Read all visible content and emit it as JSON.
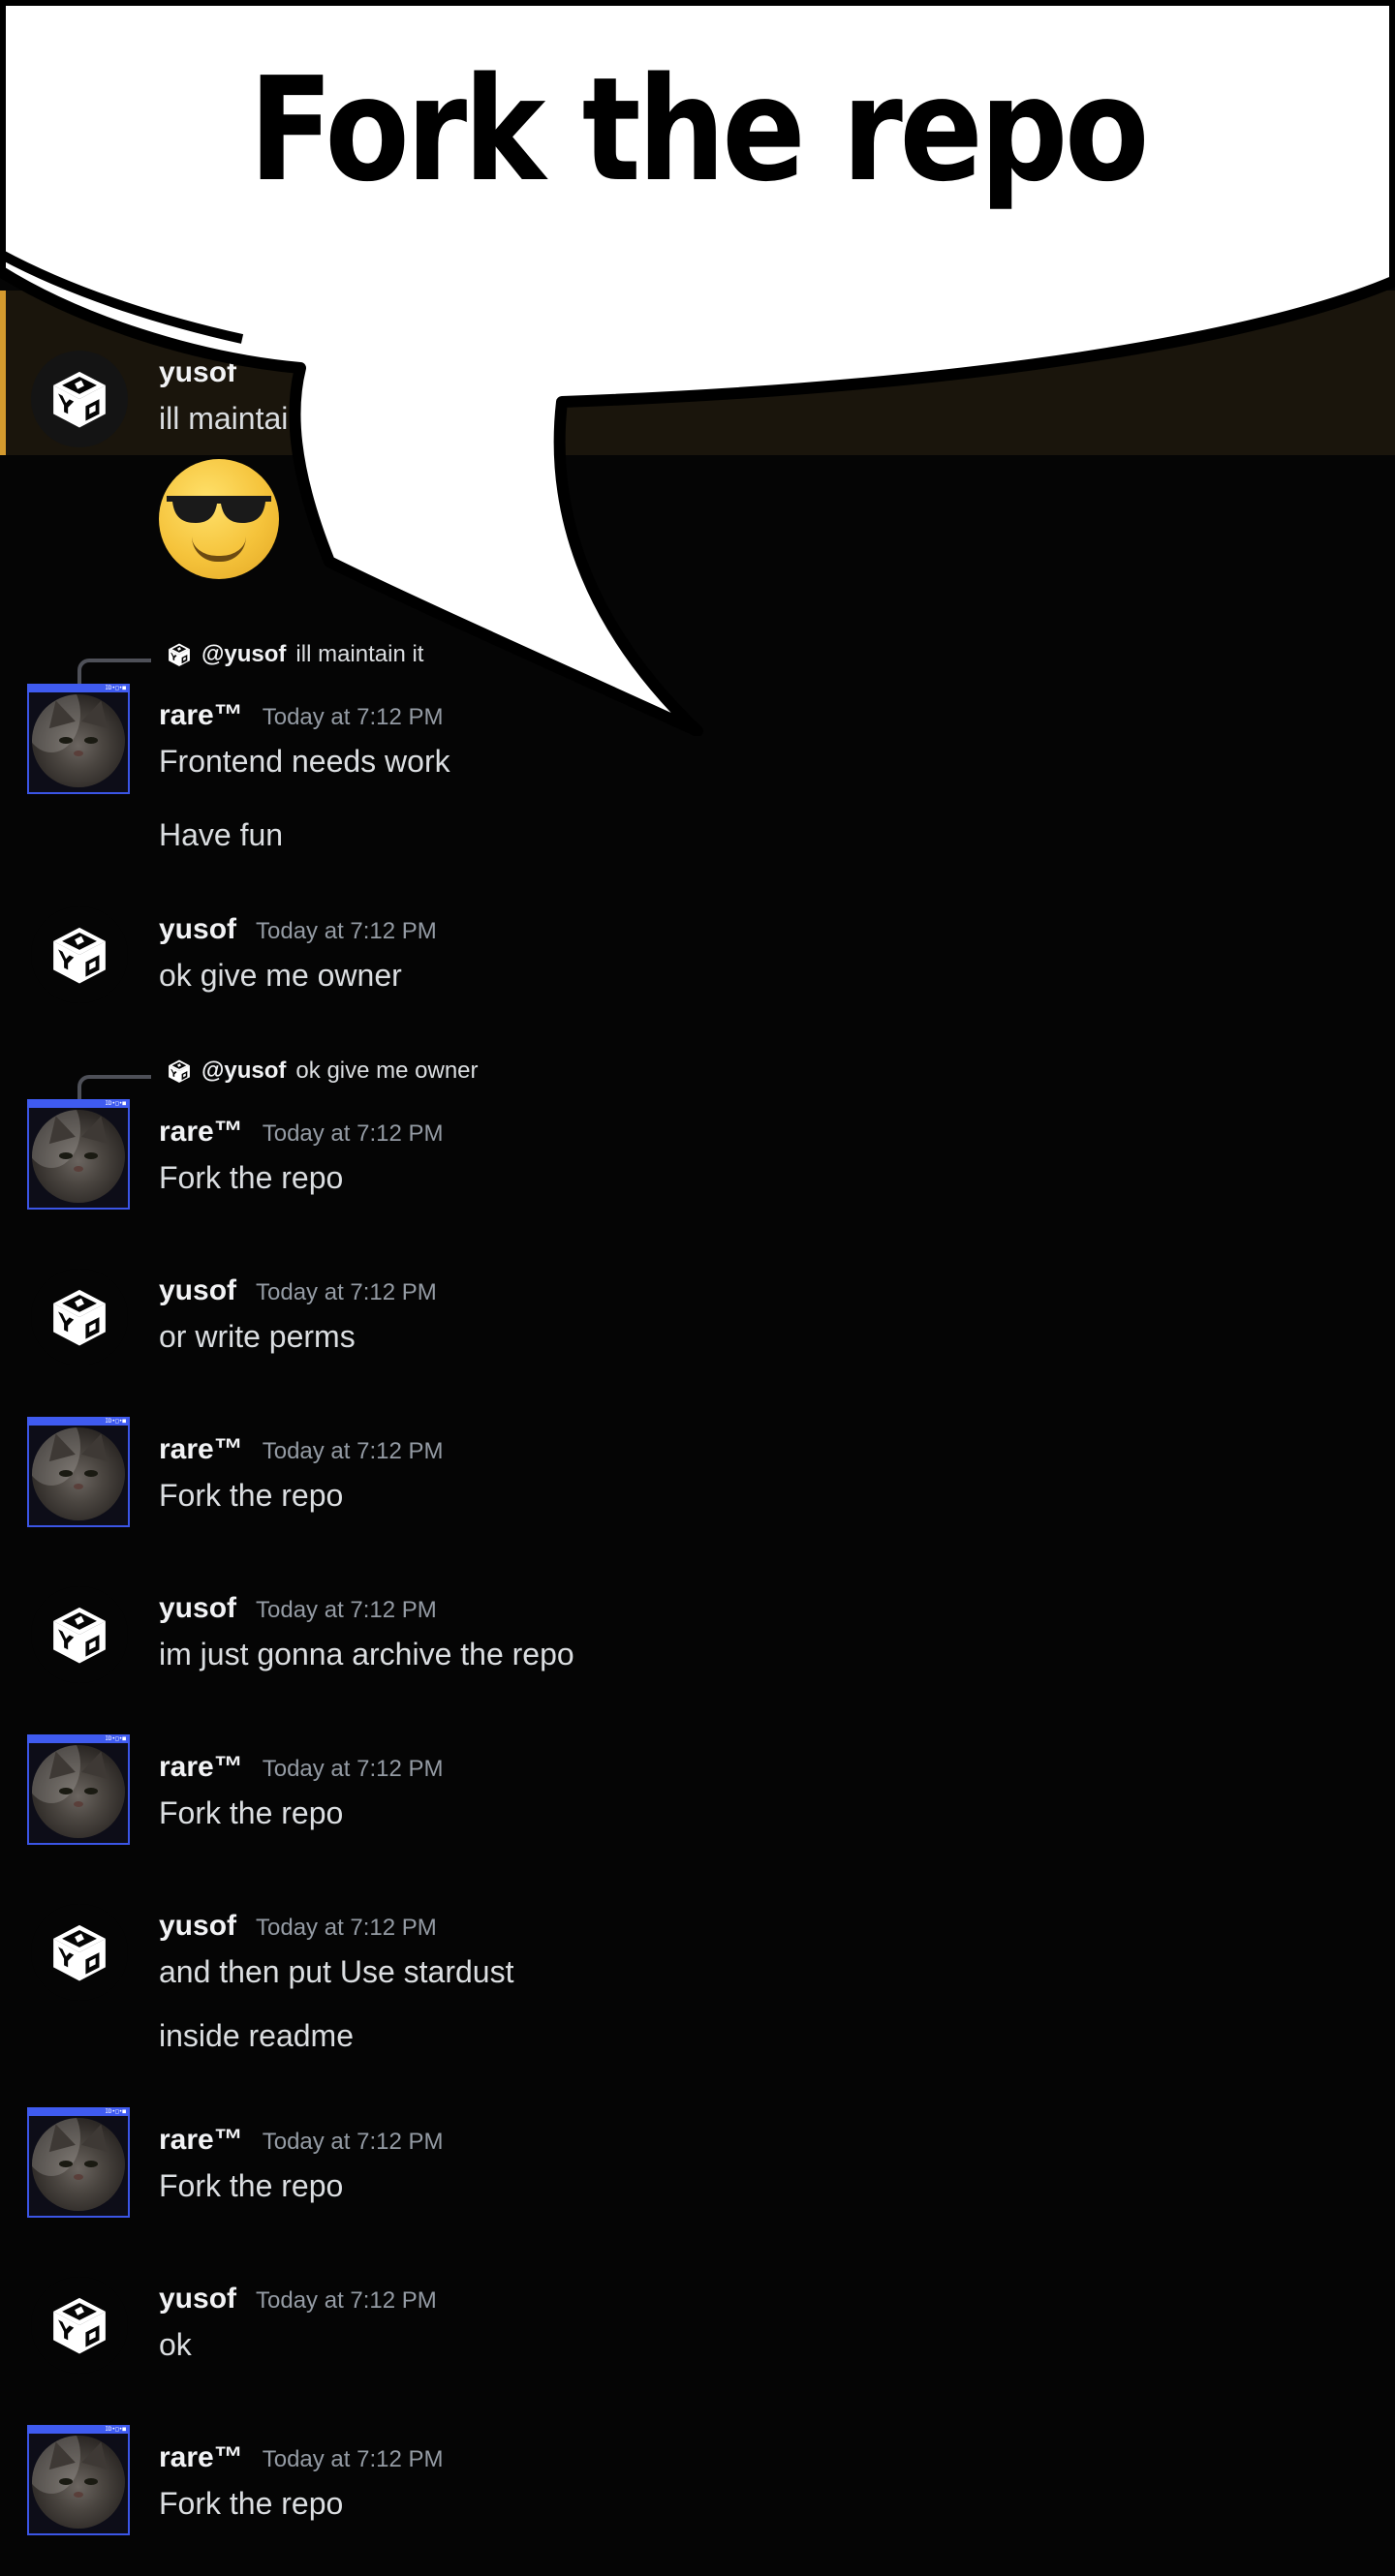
{
  "meme_caption": "Fork the repo",
  "first_message": {
    "author_partial": "yusof",
    "text_partial": "ill maintain it"
  },
  "emoji": "sunglasses-emoji",
  "messages": [
    {
      "author": "rare™",
      "timestamp": "Today at 7:12 PM",
      "reply_to": {
        "mention": "@yusof",
        "text": "ill maintain it"
      },
      "lines": [
        "Frontend needs work",
        "Have fun"
      ]
    },
    {
      "author": "yusof",
      "timestamp": "Today at 7:12 PM",
      "lines": [
        "ok give me owner"
      ]
    },
    {
      "author": "rare™",
      "timestamp": "Today at 7:12 PM",
      "reply_to": {
        "mention": "@yusof",
        "text": "ok give me owner"
      },
      "lines": [
        "Fork the repo"
      ]
    },
    {
      "author": "yusof",
      "timestamp": "Today at 7:12 PM",
      "lines": [
        "or write perms"
      ]
    },
    {
      "author": "rare™",
      "timestamp": "Today at 7:12 PM",
      "lines": [
        "Fork the repo"
      ]
    },
    {
      "author": "yusof",
      "timestamp": "Today at 7:12 PM",
      "lines": [
        "im just gonna archive the repo"
      ]
    },
    {
      "author": "rare™",
      "timestamp": "Today at 7:12 PM",
      "lines": [
        "Fork the repo"
      ]
    },
    {
      "author": "yusof",
      "timestamp": "Today at 7:12 PM",
      "lines": [
        "and then put Use stardust",
        "inside readme"
      ]
    },
    {
      "author": "rare™",
      "timestamp": "Today at 7:12 PM",
      "lines": [
        "Fork the repo"
      ]
    },
    {
      "author": "yusof",
      "timestamp": "Today at 7:12 PM",
      "lines": [
        "ok"
      ]
    },
    {
      "author": "rare™",
      "timestamp": "Today at 7:12 PM",
      "lines": [
        "Fork the repo"
      ]
    }
  ],
  "colors": {
    "background": "#050505",
    "highlight": "#1a150c",
    "highlight_bar": "#d49a2e",
    "username": "#f2f3f5",
    "timestamp": "#949ba4",
    "message_text": "#dbdee1",
    "avatar_border": "#3b55e6"
  }
}
